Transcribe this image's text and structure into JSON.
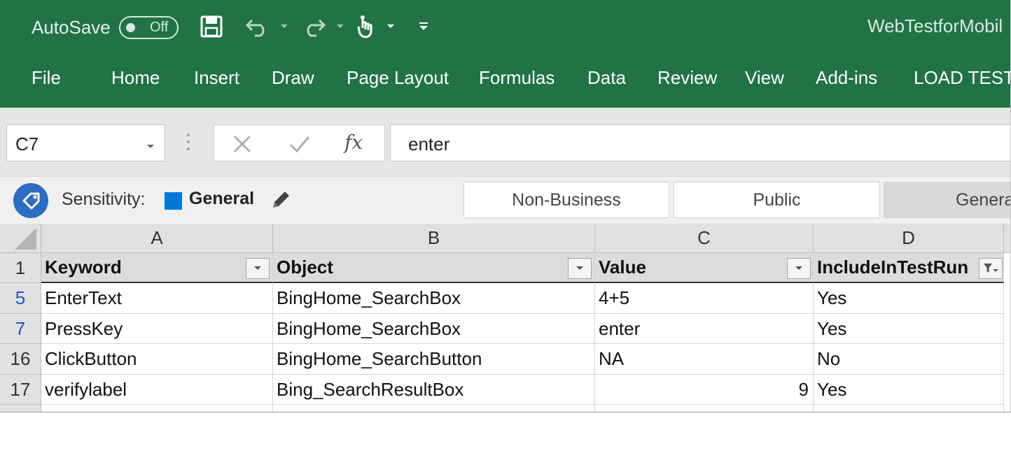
{
  "titlebar": {
    "autosave_label": "AutoSave",
    "autosave_state": "Off",
    "doc_title": "WebTestforMobil",
    "icons": [
      "save-icon",
      "undo-icon",
      "redo-icon",
      "touch-mode-icon",
      "customize-qat-icon"
    ]
  },
  "ribbon": {
    "tabs": [
      "File",
      "Home",
      "Insert",
      "Draw",
      "Page Layout",
      "Formulas",
      "Data",
      "Review",
      "View",
      "Add-ins",
      "LOAD TEST"
    ]
  },
  "formula_bar": {
    "name_box": "C7",
    "fx_label": "fx",
    "formula": "enter"
  },
  "sensitivity": {
    "label": "Sensitivity:",
    "current": "General",
    "options": [
      "Non-Business",
      "Public",
      "Genera"
    ],
    "color": "#0078d7"
  },
  "sheet": {
    "columns": [
      "A",
      "B",
      "C",
      "D"
    ],
    "header_row_number": "1",
    "headers": [
      "Keyword",
      "Object",
      "Value",
      "IncludeInTestRun"
    ],
    "rows": [
      {
        "num": "5",
        "cells": [
          "EnterText",
          "BingHome_SearchBox",
          "4+5",
          "Yes"
        ]
      },
      {
        "num": "7",
        "cells": [
          "PressKey",
          "BingHome_SearchBox",
          "enter",
          "Yes"
        ]
      },
      {
        "num": "16",
        "cells": [
          "ClickButton",
          "BingHome_SearchButton",
          "NA",
          "No"
        ]
      },
      {
        "num": "17",
        "cells": [
          "verifylabel",
          "Bing_SearchResultBox",
          "9",
          "Yes"
        ]
      }
    ]
  },
  "colors": {
    "ribbon_green": "#217346",
    "filtered_row_number": "#2a52be"
  }
}
